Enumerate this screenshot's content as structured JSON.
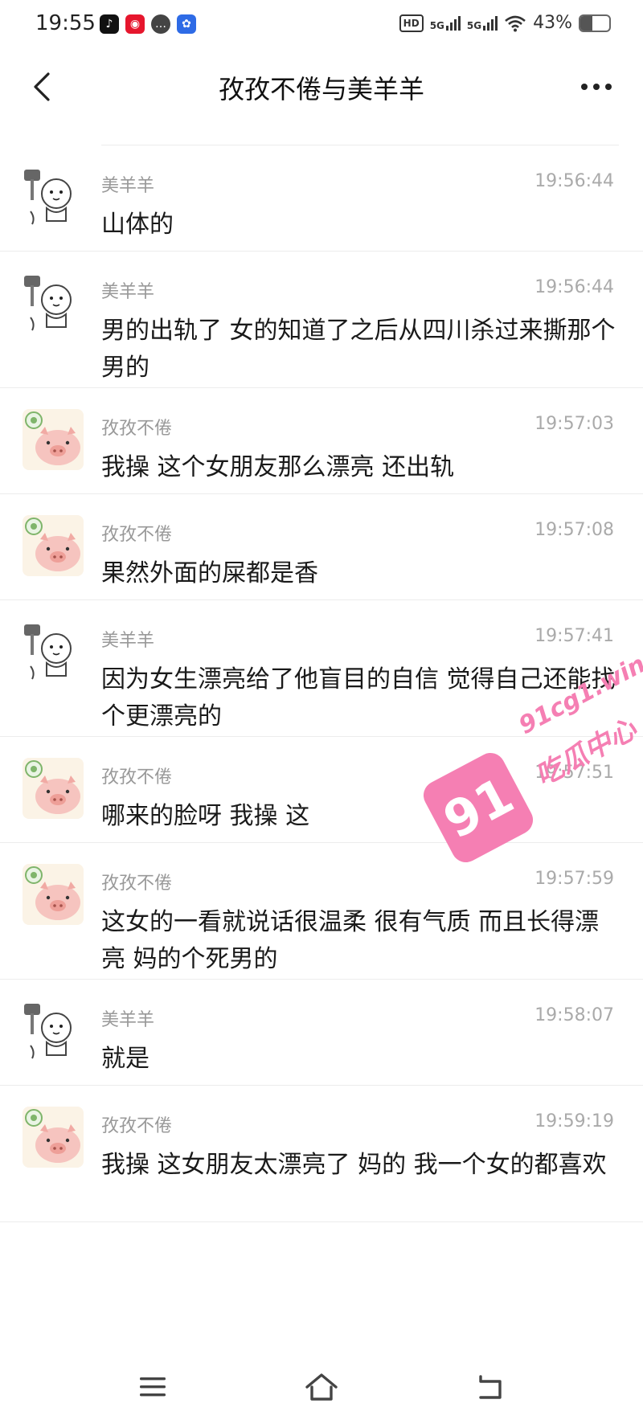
{
  "status_bar": {
    "time": "19:55",
    "app_icons": [
      "tiktok-icon",
      "weibo-icon",
      "message-icon",
      "baidu-icon"
    ],
    "hd_label": "HD",
    "net1": "5G",
    "net2": "5G",
    "battery_text": "43%",
    "battery_level": 0.43
  },
  "nav": {
    "title": "孜孜不倦与美羊羊"
  },
  "messages": [
    {
      "sender": "美羊羊",
      "time": "19:56:44",
      "text": "山体的",
      "avatar": "sheep"
    },
    {
      "sender": "美羊羊",
      "time": "19:56:44",
      "text": "男的出轨了  女的知道了之后从四川杀过来撕那个男的",
      "avatar": "sheep"
    },
    {
      "sender": "孜孜不倦",
      "time": "19:57:03",
      "text": "我操  这个女朋友那么漂亮  还出轨",
      "avatar": "pig"
    },
    {
      "sender": "孜孜不倦",
      "time": "19:57:08",
      "text": "果然外面的屎都是香",
      "avatar": "pig"
    },
    {
      "sender": "美羊羊",
      "time": "19:57:41",
      "text": "因为女生漂亮给了他盲目的自信  觉得自己还能找个更漂亮的",
      "avatar": "sheep"
    },
    {
      "sender": "孜孜不倦",
      "time": "19:57:51",
      "text": "哪来的脸呀  我操  这",
      "avatar": "pig"
    },
    {
      "sender": "孜孜不倦",
      "time": "19:57:59",
      "text": "这女的一看就说话很温柔  很有气质  而且长得漂亮  妈的个死男的",
      "avatar": "pig"
    },
    {
      "sender": "美羊羊",
      "time": "19:58:07",
      "text": "就是",
      "avatar": "sheep"
    },
    {
      "sender": "孜孜不倦",
      "time": "19:59:19",
      "text": "我操  这女朋友太漂亮了  妈的  我一个女的都喜欢",
      "avatar": "pig"
    }
  ],
  "watermark": {
    "badge": "91",
    "url": "91cg1.win",
    "name": "吃瓜中心"
  },
  "colors": {
    "watermark": "#f57fb3",
    "meta_text": "#999999"
  }
}
